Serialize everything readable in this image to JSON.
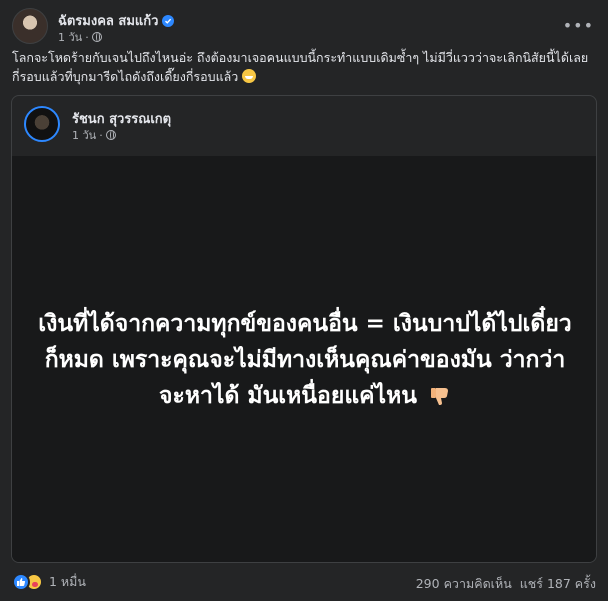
{
  "post": {
    "author": "ฉัตรมงคล สมแก้ว",
    "time": "1 วัน",
    "separator": "·",
    "text": "โลกจะโหดร้ายกับเจนไปถึงไหนอ่ะ ถึงต้องมาเจอคนแบบนี้กระทำแบบเดิมซ้ำๆ ไม่มีวี่แววว่าจะเลิกนิสัยนี้ได้เลย กี่รอบแล้วที่บุกมารีดไถดังถึงเดี๊ยงกี่รอบแล้ว"
  },
  "shared": {
    "author": "รัชนก สุวรรณเกตุ",
    "time": "1 วัน",
    "separator": "·",
    "quote": "เงินที่ได้จากความทุกข์ของคนอื่น = เงินบาปได้ไปเดี๋ยวก็หมด เพราะคุณจะไม่มีทางเห็นคุณค่าของมัน ว่ากว่าจะหาได้ มันเหนื่อยแค่ไหน"
  },
  "footer": {
    "reaction_count": "1 หมื่น",
    "comments": "290 ความคิดเห็น",
    "shares": "แชร์ 187 ครั้ง"
  },
  "icons": {
    "verified": "verified-badge-icon",
    "globe": "globe-icon",
    "more": "more-options-icon",
    "like": "like-reaction-icon",
    "care": "care-reaction-icon",
    "thumbs_down": "thumbs-down-emoji",
    "grin": "grin-emoji"
  },
  "colors": {
    "background": "#242526",
    "image_bg": "#18191a",
    "text": "#e4e6eb",
    "secondary": "#b0b3b8",
    "accent": "#2d88ff"
  }
}
